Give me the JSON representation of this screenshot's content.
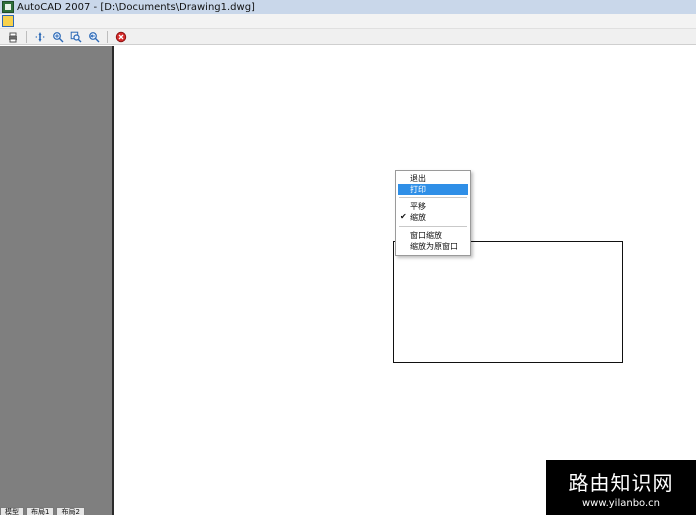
{
  "window": {
    "title": "AutoCAD 2007 - [D:\\Documents\\Drawing1.dwg]"
  },
  "toolbar": {
    "buttons": [
      {
        "name": "print-icon"
      },
      {
        "name": "pan-icon"
      },
      {
        "name": "zoom-realtime-icon"
      },
      {
        "name": "zoom-window-icon"
      },
      {
        "name": "zoom-previous-icon"
      },
      {
        "name": "close-drawing-icon"
      }
    ]
  },
  "context_menu": {
    "items": [
      {
        "label": "退出"
      },
      {
        "label": "打印",
        "selected": true
      },
      {
        "label": "平移"
      },
      {
        "label": "缩放",
        "checked": true
      },
      {
        "label": "窗口缩放"
      },
      {
        "label": "缩放为原窗口"
      }
    ]
  },
  "bottom_tabs": [
    {
      "label": "模型"
    },
    {
      "label": "布局1"
    },
    {
      "label": "布局2"
    }
  ],
  "watermark": {
    "line1": "路由知识网",
    "line2": "www.yilanbo.cn"
  }
}
